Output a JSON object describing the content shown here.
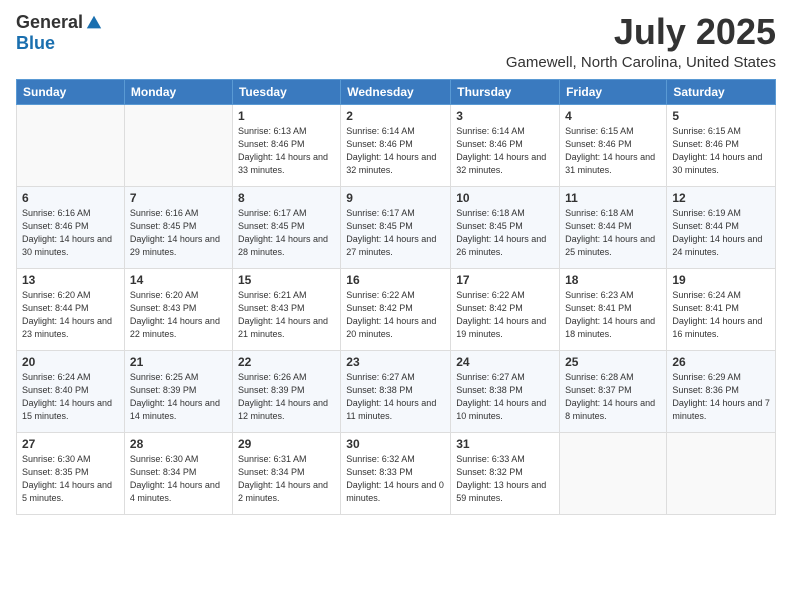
{
  "logo": {
    "general": "General",
    "blue": "Blue"
  },
  "title": "July 2025",
  "location": "Gamewell, North Carolina, United States",
  "headers": [
    "Sunday",
    "Monday",
    "Tuesday",
    "Wednesday",
    "Thursday",
    "Friday",
    "Saturday"
  ],
  "weeks": [
    [
      {
        "day": "",
        "sunrise": "",
        "sunset": "",
        "daylight": ""
      },
      {
        "day": "",
        "sunrise": "",
        "sunset": "",
        "daylight": ""
      },
      {
        "day": "1",
        "sunrise": "Sunrise: 6:13 AM",
        "sunset": "Sunset: 8:46 PM",
        "daylight": "Daylight: 14 hours and 33 minutes."
      },
      {
        "day": "2",
        "sunrise": "Sunrise: 6:14 AM",
        "sunset": "Sunset: 8:46 PM",
        "daylight": "Daylight: 14 hours and 32 minutes."
      },
      {
        "day": "3",
        "sunrise": "Sunrise: 6:14 AM",
        "sunset": "Sunset: 8:46 PM",
        "daylight": "Daylight: 14 hours and 32 minutes."
      },
      {
        "day": "4",
        "sunrise": "Sunrise: 6:15 AM",
        "sunset": "Sunset: 8:46 PM",
        "daylight": "Daylight: 14 hours and 31 minutes."
      },
      {
        "day": "5",
        "sunrise": "Sunrise: 6:15 AM",
        "sunset": "Sunset: 8:46 PM",
        "daylight": "Daylight: 14 hours and 30 minutes."
      }
    ],
    [
      {
        "day": "6",
        "sunrise": "Sunrise: 6:16 AM",
        "sunset": "Sunset: 8:46 PM",
        "daylight": "Daylight: 14 hours and 30 minutes."
      },
      {
        "day": "7",
        "sunrise": "Sunrise: 6:16 AM",
        "sunset": "Sunset: 8:45 PM",
        "daylight": "Daylight: 14 hours and 29 minutes."
      },
      {
        "day": "8",
        "sunrise": "Sunrise: 6:17 AM",
        "sunset": "Sunset: 8:45 PM",
        "daylight": "Daylight: 14 hours and 28 minutes."
      },
      {
        "day": "9",
        "sunrise": "Sunrise: 6:17 AM",
        "sunset": "Sunset: 8:45 PM",
        "daylight": "Daylight: 14 hours and 27 minutes."
      },
      {
        "day": "10",
        "sunrise": "Sunrise: 6:18 AM",
        "sunset": "Sunset: 8:45 PM",
        "daylight": "Daylight: 14 hours and 26 minutes."
      },
      {
        "day": "11",
        "sunrise": "Sunrise: 6:18 AM",
        "sunset": "Sunset: 8:44 PM",
        "daylight": "Daylight: 14 hours and 25 minutes."
      },
      {
        "day": "12",
        "sunrise": "Sunrise: 6:19 AM",
        "sunset": "Sunset: 8:44 PM",
        "daylight": "Daylight: 14 hours and 24 minutes."
      }
    ],
    [
      {
        "day": "13",
        "sunrise": "Sunrise: 6:20 AM",
        "sunset": "Sunset: 8:44 PM",
        "daylight": "Daylight: 14 hours and 23 minutes."
      },
      {
        "day": "14",
        "sunrise": "Sunrise: 6:20 AM",
        "sunset": "Sunset: 8:43 PM",
        "daylight": "Daylight: 14 hours and 22 minutes."
      },
      {
        "day": "15",
        "sunrise": "Sunrise: 6:21 AM",
        "sunset": "Sunset: 8:43 PM",
        "daylight": "Daylight: 14 hours and 21 minutes."
      },
      {
        "day": "16",
        "sunrise": "Sunrise: 6:22 AM",
        "sunset": "Sunset: 8:42 PM",
        "daylight": "Daylight: 14 hours and 20 minutes."
      },
      {
        "day": "17",
        "sunrise": "Sunrise: 6:22 AM",
        "sunset": "Sunset: 8:42 PM",
        "daylight": "Daylight: 14 hours and 19 minutes."
      },
      {
        "day": "18",
        "sunrise": "Sunrise: 6:23 AM",
        "sunset": "Sunset: 8:41 PM",
        "daylight": "Daylight: 14 hours and 18 minutes."
      },
      {
        "day": "19",
        "sunrise": "Sunrise: 6:24 AM",
        "sunset": "Sunset: 8:41 PM",
        "daylight": "Daylight: 14 hours and 16 minutes."
      }
    ],
    [
      {
        "day": "20",
        "sunrise": "Sunrise: 6:24 AM",
        "sunset": "Sunset: 8:40 PM",
        "daylight": "Daylight: 14 hours and 15 minutes."
      },
      {
        "day": "21",
        "sunrise": "Sunrise: 6:25 AM",
        "sunset": "Sunset: 8:39 PM",
        "daylight": "Daylight: 14 hours and 14 minutes."
      },
      {
        "day": "22",
        "sunrise": "Sunrise: 6:26 AM",
        "sunset": "Sunset: 8:39 PM",
        "daylight": "Daylight: 14 hours and 12 minutes."
      },
      {
        "day": "23",
        "sunrise": "Sunrise: 6:27 AM",
        "sunset": "Sunset: 8:38 PM",
        "daylight": "Daylight: 14 hours and 11 minutes."
      },
      {
        "day": "24",
        "sunrise": "Sunrise: 6:27 AM",
        "sunset": "Sunset: 8:38 PM",
        "daylight": "Daylight: 14 hours and 10 minutes."
      },
      {
        "day": "25",
        "sunrise": "Sunrise: 6:28 AM",
        "sunset": "Sunset: 8:37 PM",
        "daylight": "Daylight: 14 hours and 8 minutes."
      },
      {
        "day": "26",
        "sunrise": "Sunrise: 6:29 AM",
        "sunset": "Sunset: 8:36 PM",
        "daylight": "Daylight: 14 hours and 7 minutes."
      }
    ],
    [
      {
        "day": "27",
        "sunrise": "Sunrise: 6:30 AM",
        "sunset": "Sunset: 8:35 PM",
        "daylight": "Daylight: 14 hours and 5 minutes."
      },
      {
        "day": "28",
        "sunrise": "Sunrise: 6:30 AM",
        "sunset": "Sunset: 8:34 PM",
        "daylight": "Daylight: 14 hours and 4 minutes."
      },
      {
        "day": "29",
        "sunrise": "Sunrise: 6:31 AM",
        "sunset": "Sunset: 8:34 PM",
        "daylight": "Daylight: 14 hours and 2 minutes."
      },
      {
        "day": "30",
        "sunrise": "Sunrise: 6:32 AM",
        "sunset": "Sunset: 8:33 PM",
        "daylight": "Daylight: 14 hours and 0 minutes."
      },
      {
        "day": "31",
        "sunrise": "Sunrise: 6:33 AM",
        "sunset": "Sunset: 8:32 PM",
        "daylight": "Daylight: 13 hours and 59 minutes."
      },
      {
        "day": "",
        "sunrise": "",
        "sunset": "",
        "daylight": ""
      },
      {
        "day": "",
        "sunrise": "",
        "sunset": "",
        "daylight": ""
      }
    ]
  ]
}
